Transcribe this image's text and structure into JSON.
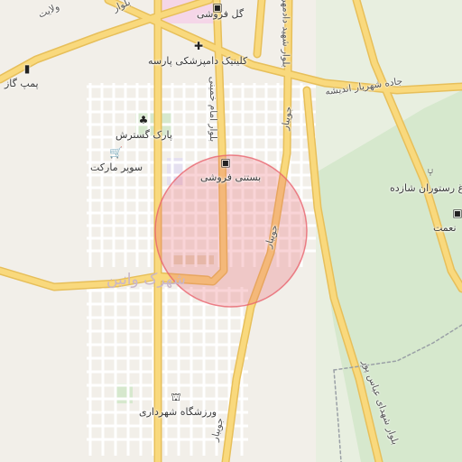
{
  "map": {
    "district_label": "شهرک وانین",
    "places": [
      {
        "label": "گل فروشی",
        "icon": "shop-icon"
      },
      {
        "label": "کلینیک دامپزشکی پارسه",
        "icon": "clinic-icon"
      },
      {
        "label": "پارک گسترش",
        "icon": "park-icon"
      },
      {
        "label": "سوپر مارکت",
        "icon": "cart-icon"
      },
      {
        "label": "بستنی فروشی",
        "icon": "shop-icon"
      },
      {
        "label": "پمپ گاز",
        "icon": "fuel-icon"
      },
      {
        "label": "باغ رستوران شازده",
        "icon": "restaurant-icon"
      },
      {
        "label": "ورزشگاه شهرداری",
        "icon": "stadium-icon"
      },
      {
        "label": "نعمت",
        "icon": "shop-icon"
      }
    ],
    "roads": [
      {
        "label": "جاده شهریار اندیشه"
      },
      {
        "label": "بلوار شهید دادمهر"
      },
      {
        "label": "بلوار امام خمینی"
      },
      {
        "label": "جویبار"
      },
      {
        "label": "جویبار"
      },
      {
        "label": "جویبار"
      },
      {
        "label": "بلوار شهدای عباس پور"
      },
      {
        "label": "بلوار"
      },
      {
        "label": "ولایت"
      }
    ],
    "colors": {
      "background": "#f2efe9",
      "major_road": "#f9d97d",
      "road_outline": "#e7bf5a",
      "minor_road": "#ffffff",
      "park": "#d6e8cd",
      "highlight_circle": "#e8646e"
    }
  }
}
